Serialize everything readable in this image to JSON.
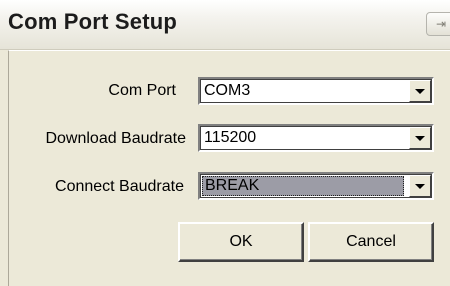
{
  "window": {
    "title": "Com Port Setup",
    "title_button_icon": "restore-icon",
    "title_button_glyph": "⇥"
  },
  "form": {
    "com_port": {
      "label": "Com Port",
      "value": "COM3"
    },
    "download_baudrate": {
      "label": "Download Baudrate",
      "value": "115200"
    },
    "connect_baudrate": {
      "label": "Connect Baudrate",
      "value": "BREAK"
    }
  },
  "buttons": {
    "ok_label": "OK",
    "cancel_label": "Cancel"
  },
  "colors": {
    "dialog_background": "#ece9d8",
    "selection_highlight": "#9c9ca6"
  }
}
